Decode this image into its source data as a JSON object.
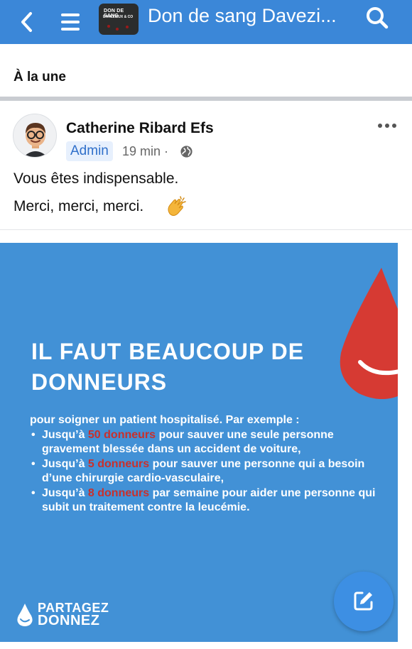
{
  "topbar": {
    "title": "Don de sang Davezi...",
    "group_thumbnail_text_1": "DON DE SANG",
    "group_thumbnail_text_2": "DAVEZIEUX & CO",
    "accent_color": "#3b87d8"
  },
  "section": {
    "label": "À la une"
  },
  "post": {
    "author": "Catherine Ribard Efs",
    "badge": "Admin",
    "time": "19 min ·",
    "text_line1": "Vous êtes indispensable.",
    "text_line2": "Merci, merci, merci.",
    "emoji": "clapping-hands-icon"
  },
  "poster": {
    "headline_line1": "IL FAUT BEAUCOUP DE",
    "headline_line2": "DONNEURS",
    "intro": "pour soigner un patient hospitalisé. Par exemple :",
    "bullets": [
      {
        "pre": "Jusqu’à ",
        "highlight": "50 donneurs",
        "post": " pour sauver une seule personne gravement blessée dans un accident de voiture,"
      },
      {
        "pre": "Jusqu’à ",
        "highlight": "5 donneurs",
        "post": " pour sauver une personne qui a besoin d’une chirurgie cardio-vasculaire,"
      },
      {
        "pre": "Jusqu’à ",
        "highlight": "8 donneurs",
        "post": " par semaine pour aider une personne qui subit un traitement contre la leucémie."
      }
    ],
    "logo_line1": "PARTAGEZ",
    "logo_line2": "DONNEZ",
    "background_color": "#4291d6",
    "highlight_color": "#c9302c"
  },
  "fab": {
    "icon": "compose-icon"
  }
}
